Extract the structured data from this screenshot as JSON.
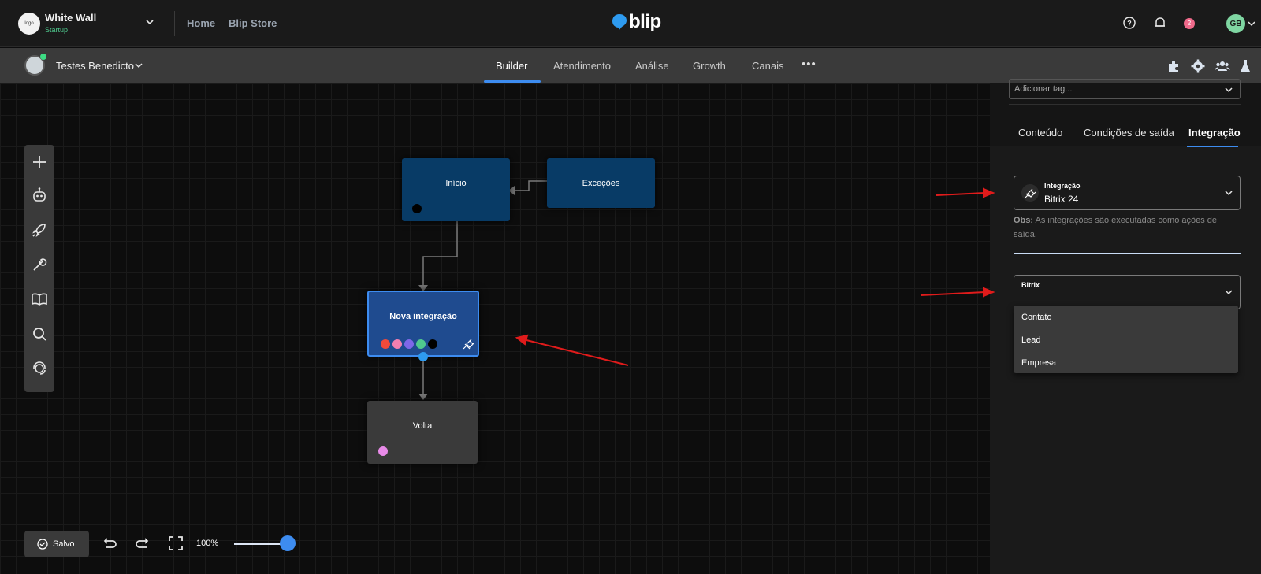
{
  "header": {
    "org_name": "White Wall",
    "org_plan": "Startup",
    "nav": [
      "Home",
      "Blip Store"
    ],
    "brand": "blip",
    "notifications_count": "2",
    "user_initials": "GB",
    "icons": [
      "help-icon",
      "bell-icon",
      "chevron-down-icon"
    ]
  },
  "subheader": {
    "bot_name": "Testes Benedicto",
    "tabs": [
      "Builder",
      "Atendimento",
      "Análise",
      "Growth",
      "Canais"
    ],
    "active_tab": "Builder",
    "more": "•••",
    "icons": [
      "puzzle-icon",
      "gear-icon",
      "team-icon",
      "flask-icon"
    ]
  },
  "canvas": {
    "nodes": {
      "inicio": "Início",
      "excecoes": "Exceções",
      "nova_integracao": "Nova integração",
      "volta": "Volta"
    },
    "tag_colors": [
      "#f04a3a",
      "#f27fb0",
      "#7e67e8",
      "#4fc98e",
      "#000000"
    ],
    "colors": {
      "start_node": "#083b66",
      "selected_node": "#1f4b8f",
      "selected_border": "#3d8cf0",
      "plain_node": "#3a3a3a",
      "volta_dot": "#e88ae8"
    }
  },
  "toolbox": {
    "tools": [
      "plus-icon",
      "bot-icon",
      "rocket-icon",
      "wrench-icon",
      "book-icon",
      "search-icon",
      "support-icon"
    ]
  },
  "bottombar": {
    "save_label": "Salvo",
    "zoom": "100%",
    "zoom_level": 1.0
  },
  "panel": {
    "tag_placeholder": "Adicionar tag...",
    "tabs": [
      "Conteúdo",
      "Condições de saída",
      "Integração"
    ],
    "active_tab": "Integração",
    "integration_label": "Integração",
    "integration_value": "Bitrix 24",
    "obs_prefix": "Obs:",
    "obs_text": " As integrações são executadas como ações de saída.",
    "bitrix_label": "Bitrix",
    "bitrix_options": [
      "Contato",
      "Lead",
      "Empresa"
    ]
  },
  "annotation_color": "#e01b1b"
}
